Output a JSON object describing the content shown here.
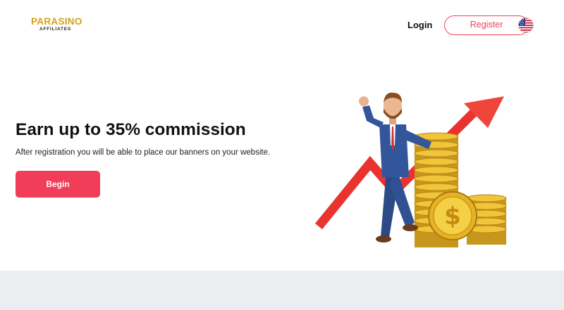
{
  "header": {
    "logo": {
      "main": "PARASINO",
      "sub": "AFFILIATES"
    },
    "login_label": "Login",
    "register_label": "Register",
    "language_flag": "us-flag-icon"
  },
  "hero": {
    "title": "Earn up to 35% commission",
    "subtitle": "After registration you will be able to place our banners on your website.",
    "cta_label": "Begin",
    "illustration": "businessman-with-coin-stacks-and-rising-arrow"
  },
  "colors": {
    "accent": "#f23d58",
    "logo_gold": "#d4a017",
    "footer_band": "#ecedf1"
  }
}
